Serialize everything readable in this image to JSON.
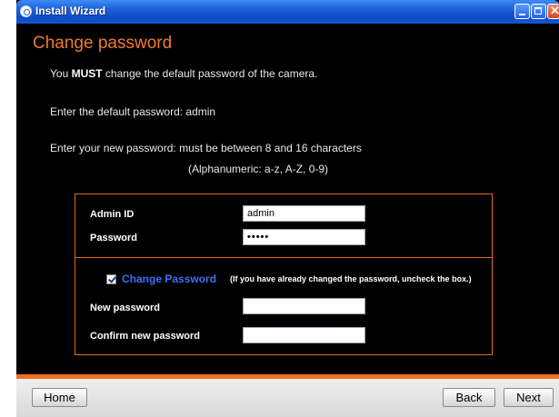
{
  "window": {
    "title": "Install Wizard",
    "close_glyph": "✕"
  },
  "page": {
    "title": "Change password",
    "line1_prefix": "You ",
    "line1_must": "MUST",
    "line1_suffix": " change the default password of the camera.",
    "line2": "Enter the default password: admin",
    "line3": "Enter your new password: must be between 8 and 16 characters",
    "line4": "(Alphanumeric: a-z, A-Z, 0-9)"
  },
  "form": {
    "admin_id_label": "Admin ID",
    "admin_id_value": "admin",
    "password_label": "Password",
    "password_value": "•••••",
    "change_password_checked": true,
    "change_password_label": "Change Password",
    "change_password_note": "(If you have already changed the password, uncheck the box.)",
    "new_password_label": "New password",
    "new_password_value": "",
    "confirm_password_label": "Confirm new password",
    "confirm_password_value": ""
  },
  "footer": {
    "home_label": "Home",
    "back_label": "Back",
    "next_label": "Next"
  },
  "colors": {
    "accent": "#f07a2c",
    "link_blue": "#3d6ef5",
    "background": "#000000"
  }
}
